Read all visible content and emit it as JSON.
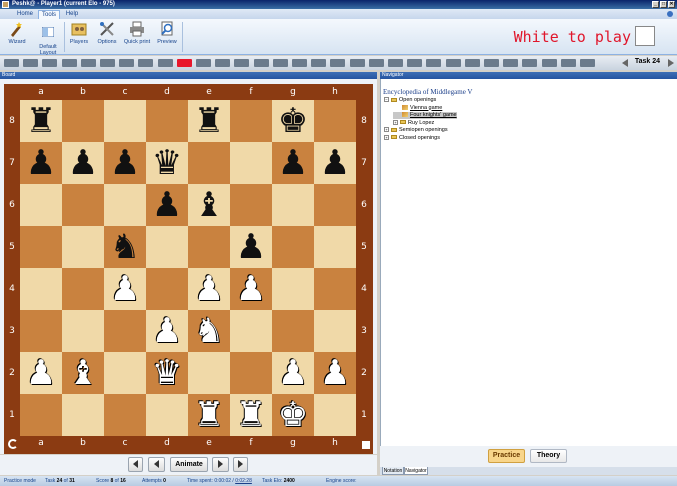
{
  "window": {
    "title": "Peshk@ - Player1 (current Elo - 975)",
    "buttons": [
      "_",
      "□",
      "✕"
    ]
  },
  "ribbon": {
    "tabs": [
      "Home",
      "Tools",
      "Help"
    ],
    "active_tab": "Tools",
    "buttons": [
      {
        "label": "Wizard",
        "icon": "wizard-icon"
      },
      {
        "label": "Default\nLayout",
        "icon": "layout-icon"
      },
      {
        "label": "Players",
        "icon": "players-icon"
      },
      {
        "label": "Options",
        "icon": "options-icon"
      },
      {
        "label": "Quick print",
        "icon": "print-icon"
      },
      {
        "label": "Preview",
        "icon": "preview-icon"
      }
    ]
  },
  "to_move": {
    "text": "White to play",
    "color": "#e0162b"
  },
  "progress": {
    "segments": 31,
    "current": 9,
    "task_label": "Task 24"
  },
  "board": {
    "pane_title": "Board",
    "files": [
      "a",
      "b",
      "c",
      "d",
      "e",
      "f",
      "g",
      "h"
    ],
    "ranks": [
      "8",
      "7",
      "6",
      "5",
      "4",
      "3",
      "2",
      "1"
    ],
    "position": [
      [
        "br",
        "",
        "",
        "",
        "br",
        "",
        "bk",
        ""
      ],
      [
        "bp",
        "bp",
        "bp",
        "bq",
        "",
        "",
        "bp",
        "bp"
      ],
      [
        "",
        "",
        "",
        "bp",
        "bb",
        "",
        "",
        ""
      ],
      [
        "",
        "",
        "bn",
        "",
        "",
        "bp",
        "",
        ""
      ],
      [
        "",
        "",
        "wp",
        "",
        "wp",
        "wp",
        "",
        ""
      ],
      [
        "",
        "",
        "",
        "wp",
        "wn",
        "",
        "",
        ""
      ],
      [
        "wp",
        "wb",
        "",
        "wq",
        "",
        "",
        "wp",
        "wp"
      ],
      [
        "",
        "",
        "",
        "",
        "wr",
        "wr",
        "wk",
        ""
      ]
    ],
    "controls": {
      "animate_label": "Animate"
    }
  },
  "navigator": {
    "pane_title": "Navigator",
    "heading": "Encyclopedia of Middlegame V",
    "tree": [
      {
        "label": "Open openings",
        "level": 0,
        "expander": "−",
        "kind": "folder"
      },
      {
        "label": "Vienna game",
        "level": 1,
        "kind": "doc",
        "link": true
      },
      {
        "label": "Four knights' game",
        "level": 1,
        "kind": "doc",
        "link": true,
        "selected": true
      },
      {
        "label": "Ruy Lopez",
        "level": 1,
        "expander": "+",
        "kind": "folder"
      },
      {
        "label": "Semiopen openings",
        "level": 0,
        "expander": "+",
        "kind": "folder"
      },
      {
        "label": "Closed openings",
        "level": 0,
        "expander": "+",
        "kind": "folder"
      }
    ],
    "buttons": {
      "practice": "Practice",
      "theory": "Theory"
    },
    "tabs": [
      "Notation",
      "Navigator"
    ],
    "active_tab": "Navigator"
  },
  "status": {
    "mode": "Practice mode",
    "task_prefix": "Task ",
    "task_num": "24",
    "task_of": " of ",
    "task_total": "31",
    "score_prefix": "Score ",
    "score_num": "8",
    "score_of": " of ",
    "score_total": "16",
    "attempts_prefix": "Attempts ",
    "attempts_num": "0",
    "time_prefix": "Time spent: 0:00:02 / ",
    "time_link": "0:02:28",
    "elo_prefix": "Task Elo: ",
    "elo_num": "2400",
    "engine": "Engine score:"
  }
}
